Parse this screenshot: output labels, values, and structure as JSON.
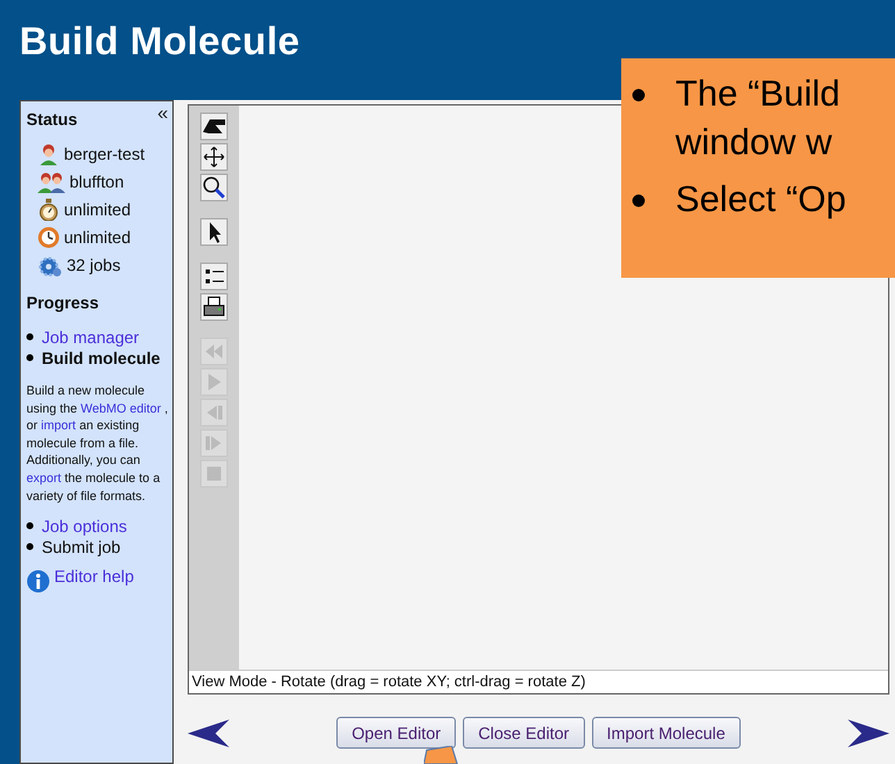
{
  "header": {
    "title": "Build Molecule"
  },
  "sidebar": {
    "collapse_glyph": "«",
    "status_heading": "Status",
    "status_items": [
      {
        "kind": "user",
        "label": "berger-test"
      },
      {
        "kind": "group",
        "label": "bluffton"
      },
      {
        "kind": "stopwatch",
        "label": "unlimited"
      },
      {
        "kind": "clock",
        "label": "unlimited"
      },
      {
        "kind": "jobs",
        "label": "32 jobs"
      }
    ],
    "progress_heading": "Progress",
    "progress_top": [
      {
        "kind": "link",
        "label": "Job manager"
      },
      {
        "kind": "current",
        "label": "Build molecule"
      }
    ],
    "description": [
      {
        "link": false,
        "text": "Build a new molecule using the"
      },
      {
        "link": true,
        "text": "WebMO editor"
      },
      {
        "link": false,
        "text": ", or"
      },
      {
        "link": true,
        "text": "import"
      },
      {
        "link": false,
        "text": "an existing molecule from a file. Additionally, you can"
      },
      {
        "link": true,
        "text": "export"
      },
      {
        "link": false,
        "text": "the molecule to a variety of file formats."
      }
    ],
    "progress_bottom": [
      {
        "kind": "link",
        "label": "Job options"
      },
      {
        "kind": "plain",
        "label": "Submit job"
      }
    ],
    "help_link": "Editor help"
  },
  "editor": {
    "tool_groups": [
      [
        {
          "kind": "rotate",
          "disabled": false
        },
        {
          "kind": "move",
          "disabled": false
        },
        {
          "kind": "zoom",
          "disabled": false
        }
      ],
      [
        {
          "kind": "select",
          "disabled": false
        }
      ],
      [
        {
          "kind": "list",
          "disabled": false
        },
        {
          "kind": "print",
          "disabled": false
        }
      ],
      [
        {
          "kind": "rewind",
          "disabled": true
        },
        {
          "kind": "play",
          "disabled": true
        },
        {
          "kind": "step-back",
          "disabled": true
        },
        {
          "kind": "step-forward",
          "disabled": true
        },
        {
          "kind": "stop",
          "disabled": true
        }
      ]
    ],
    "status_line": "View Mode - Rotate (drag = rotate XY; ctrl-drag = rotate Z)"
  },
  "buttons": [
    "Open Editor",
    "Close Editor",
    "Import Molecule"
  ],
  "callout": {
    "bullets": [
      {
        "lines": [
          "The “Build",
          "window w"
        ]
      },
      {
        "lines": [
          "Select “Op"
        ]
      }
    ]
  }
}
